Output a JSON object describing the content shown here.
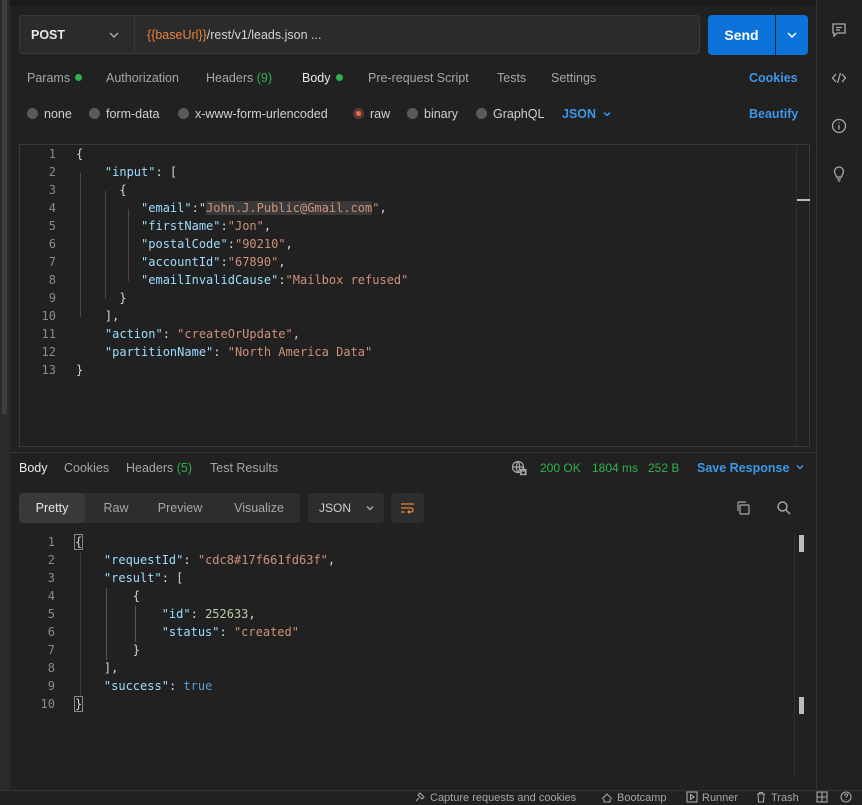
{
  "request": {
    "method": "POST",
    "url_var": "{{baseUrl}}",
    "url_path": "/rest/v1/leads.json ...",
    "send_label": "Send"
  },
  "tabs": {
    "params": "Params",
    "authorization": "Authorization",
    "headers": "Headers",
    "headers_count": "(9)",
    "body": "Body",
    "prerequest": "Pre-request Script",
    "tests": "Tests",
    "settings": "Settings",
    "cookies": "Cookies"
  },
  "body_types": {
    "none": "none",
    "form_data": "form-data",
    "urlencoded": "x-www-form-urlencoded",
    "raw": "raw",
    "binary": "binary",
    "graphql": "GraphQL",
    "language": "JSON",
    "beautify": "Beautify",
    "selected": "raw"
  },
  "request_body": {
    "line_numbers": [
      "1",
      "2",
      "3",
      "4",
      "5",
      "6",
      "7",
      "8",
      "9",
      "10",
      "11",
      "12",
      "13"
    ],
    "input_key": "\"input\"",
    "email_key": "\"email\"",
    "email_val": "John.J.Public@Gmail.com",
    "firstName_key": "\"firstName\"",
    "firstName_val": "\"Jon\"",
    "postalCode_key": "\"postalCode\"",
    "postalCode_val": "\"90210\"",
    "accountId_key": "\"accountId\"",
    "accountId_val": "\"67890\"",
    "emailInvalidCause_key": "\"emailInvalidCause\"",
    "emailInvalidCause_val": "\"Mailbox refused\"",
    "action_key": "\"action\"",
    "action_val": "\"createOrUpdate\"",
    "partitionName_key": "\"partitionName\"",
    "partitionName_val": "\"North America Data\""
  },
  "response": {
    "tabs": {
      "body": "Body",
      "cookies": "Cookies",
      "headers": "Headers",
      "headers_count": "(5)",
      "test_results": "Test Results"
    },
    "status": "200 OK",
    "time": "1804 ms",
    "size": "252 B",
    "save_label": "Save Response",
    "views": {
      "pretty": "Pretty",
      "raw": "Raw",
      "preview": "Preview",
      "visualize": "Visualize"
    },
    "language": "JSON",
    "line_numbers": [
      "1",
      "2",
      "3",
      "4",
      "5",
      "6",
      "7",
      "8",
      "9",
      "10"
    ],
    "requestId_key": "\"requestId\"",
    "requestId_val": "\"cdc8#17f661fd63f\"",
    "result_key": "\"result\"",
    "id_key": "\"id\"",
    "id_val": "252633",
    "status_key": "\"status\"",
    "status_val": "\"created\"",
    "success_key": "\"success\"",
    "success_val": "true"
  },
  "statusbar": {
    "capture": "Capture requests and cookies",
    "bootcamp": "Bootcamp",
    "runner": "Runner",
    "trash": "Trash"
  },
  "colors": {
    "accent": "#0b73d9",
    "link": "#3d97e8",
    "success": "#2fb14d",
    "variable": "#e8823c"
  }
}
